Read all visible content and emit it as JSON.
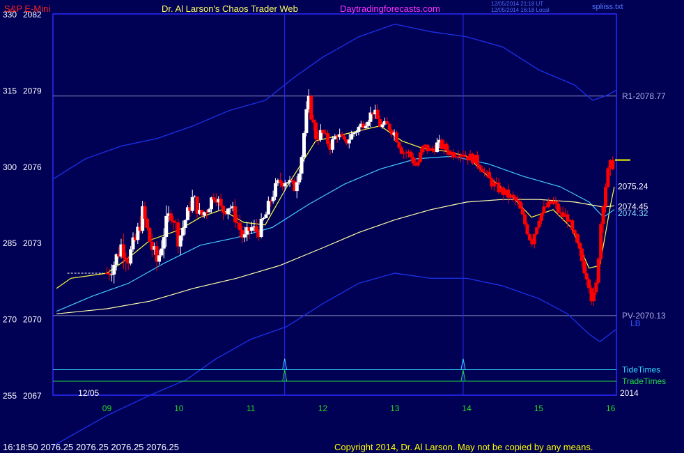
{
  "header": {
    "symbol": "S&P E-Mini",
    "title": "Dr. Al Larson's Chaos Trader Web",
    "site": "Daytradingforecasts.com",
    "utc_time": "12/05/2014 21:18 UT",
    "local_time": "12/05/2014 16:18 Local",
    "file": "spliiss.txt"
  },
  "footer": {
    "quote": "16:18:50  2076.25 2076.25 2076.25 2076.25",
    "copyright": "Copyright 2014, Dr. Al Larson. May not be copied by any means."
  },
  "colors": {
    "background": "#000055",
    "frame": "#2a2aff",
    "up_bar": "#ffffff",
    "down_bar": "#ff0000",
    "ema_fast": "#ffff44",
    "ema_mid": "#44ccff",
    "ema_slow": "#ffffaa",
    "band": "#1a2fe0",
    "tide": "#33ddff",
    "trade": "#22dd44",
    "time_label": "#22dd22",
    "price_label": "#ffff00"
  },
  "chart_data": {
    "type": "candlestick",
    "title": "S&P E-Mini",
    "y_axis": {
      "ylim": [
        2067,
        2082
      ],
      "ticks": [
        {
          "value": 2067,
          "label": "2067",
          "alt": "255"
        },
        {
          "value": 2070,
          "label": "2070",
          "alt": "270"
        },
        {
          "value": 2073,
          "label": "2073",
          "alt": "285"
        },
        {
          "value": 2076,
          "label": "2076",
          "alt": "300"
        },
        {
          "value": 2079,
          "label": "2079",
          "alt": "315"
        },
        {
          "value": 2082,
          "label": "2082",
          "alt": "330"
        }
      ]
    },
    "x_axis": {
      "xlim": [
        8.25,
        16.08
      ],
      "ticks": [
        "09",
        "10",
        "11",
        "12",
        "13",
        "14",
        "15",
        "16"
      ],
      "date_label": "12/05",
      "year_label": "2014"
    },
    "levels": [
      {
        "name": "R1",
        "label": "R1-2078.77",
        "value": 2078.77
      },
      {
        "name": "PV",
        "label": "PV-2070.13",
        "value": 2070.13
      }
    ],
    "band_label": "LB",
    "prev_close": {
      "from": 8.45,
      "to": 8.95,
      "value": 2071.8
    },
    "vertical_times": [
      11.47,
      13.95
    ],
    "timing_lines": [
      {
        "name": "TideTimes",
        "value": 2068.0,
        "spikes": [
          11.47,
          13.95
        ]
      },
      {
        "name": "TradeTimes",
        "value": 2067.55,
        "spikes": [
          11.47,
          13.95
        ]
      }
    ],
    "price_tags": [
      "2075.24",
      "2074.45",
      "2074.32"
    ],
    "last_price_marker": 2076.25,
    "path": [
      [
        9.0,
        2071.8
      ],
      [
        9.1,
        2072.2
      ],
      [
        9.2,
        2072.9
      ],
      [
        9.3,
        2072.4
      ],
      [
        9.4,
        2073.1
      ],
      [
        9.5,
        2074.2
      ],
      [
        9.6,
        2073.0
      ],
      [
        9.7,
        2072.2
      ],
      [
        9.8,
        2073.5
      ],
      [
        9.9,
        2074.3
      ],
      [
        10.0,
        2073.1
      ],
      [
        10.1,
        2074.0
      ],
      [
        10.2,
        2074.8
      ],
      [
        10.3,
        2074.0
      ],
      [
        10.4,
        2074.4
      ],
      [
        10.5,
        2075.0
      ],
      [
        10.6,
        2074.2
      ],
      [
        10.7,
        2074.5
      ],
      [
        10.8,
        2073.9
      ],
      [
        10.9,
        2073.1
      ],
      [
        11.0,
        2073.6
      ],
      [
        11.1,
        2073.4
      ],
      [
        11.2,
        2074.0
      ],
      [
        11.3,
        2074.9
      ],
      [
        11.4,
        2075.4
      ],
      [
        11.5,
        2075.5
      ],
      [
        11.6,
        2075.1
      ],
      [
        11.7,
        2076.3
      ],
      [
        11.75,
        2077.6
      ],
      [
        11.8,
        2078.6
      ],
      [
        11.9,
        2077.2
      ],
      [
        12.0,
        2077.3
      ],
      [
        12.1,
        2076.8
      ],
      [
        12.2,
        2077.3
      ],
      [
        12.3,
        2076.9
      ],
      [
        12.45,
        2077.4
      ],
      [
        12.6,
        2077.8
      ],
      [
        12.7,
        2078.2
      ],
      [
        12.8,
        2077.6
      ],
      [
        12.9,
        2077.6
      ],
      [
        13.0,
        2077.3
      ],
      [
        13.1,
        2076.6
      ],
      [
        13.2,
        2076.5
      ],
      [
        13.3,
        2076.0
      ],
      [
        13.4,
        2076.8
      ],
      [
        13.5,
        2076.6
      ],
      [
        13.6,
        2076.9
      ],
      [
        13.7,
        2076.7
      ],
      [
        13.8,
        2076.5
      ],
      [
        13.9,
        2076.6
      ],
      [
        14.0,
        2076.4
      ],
      [
        14.1,
        2076.3
      ],
      [
        14.2,
        2076.0
      ],
      [
        14.3,
        2075.5
      ],
      [
        14.4,
        2075.2
      ],
      [
        14.5,
        2075.0
      ],
      [
        14.6,
        2074.8
      ],
      [
        14.7,
        2074.6
      ],
      [
        14.8,
        2073.8
      ],
      [
        14.9,
        2073.0
      ],
      [
        15.0,
        2074.0
      ],
      [
        15.1,
        2074.4
      ],
      [
        15.2,
        2074.6
      ],
      [
        15.3,
        2074.1
      ],
      [
        15.4,
        2074.0
      ],
      [
        15.5,
        2073.1
      ],
      [
        15.6,
        2072.3
      ],
      [
        15.7,
        2071.5
      ],
      [
        15.75,
        2070.6
      ],
      [
        15.8,
        2071.3
      ],
      [
        15.85,
        2073.4
      ],
      [
        15.9,
        2074.8
      ],
      [
        15.95,
        2075.6
      ],
      [
        16.0,
        2076.0
      ],
      [
        16.05,
        2076.25
      ]
    ],
    "series": [
      {
        "name": "ema_fast",
        "points": [
          [
            8.3,
            2071.2
          ],
          [
            8.5,
            2071.6
          ],
          [
            9.0,
            2071.8
          ],
          [
            9.3,
            2072.4
          ],
          [
            9.6,
            2073.1
          ],
          [
            10.0,
            2073.5
          ],
          [
            10.3,
            2074.0
          ],
          [
            10.6,
            2074.3
          ],
          [
            10.9,
            2073.8
          ],
          [
            11.2,
            2073.7
          ],
          [
            11.5,
            2075.2
          ],
          [
            11.7,
            2076.1
          ],
          [
            11.9,
            2077.0
          ],
          [
            12.2,
            2077.2
          ],
          [
            12.5,
            2077.4
          ],
          [
            12.8,
            2077.6
          ],
          [
            13.1,
            2077.0
          ],
          [
            13.4,
            2076.7
          ],
          [
            13.7,
            2076.6
          ],
          [
            14.0,
            2076.4
          ],
          [
            14.3,
            2075.6
          ],
          [
            14.6,
            2074.9
          ],
          [
            14.9,
            2074.0
          ],
          [
            15.2,
            2074.3
          ],
          [
            15.45,
            2073.6
          ],
          [
            15.7,
            2072.0
          ],
          [
            15.85,
            2072.1
          ],
          [
            16.0,
            2074.5
          ],
          [
            16.05,
            2075.2
          ]
        ]
      },
      {
        "name": "ema_mid",
        "points": [
          [
            8.3,
            2070.3
          ],
          [
            8.8,
            2070.9
          ],
          [
            9.3,
            2071.4
          ],
          [
            9.8,
            2072.2
          ],
          [
            10.3,
            2072.9
          ],
          [
            10.8,
            2073.2
          ],
          [
            11.3,
            2073.6
          ],
          [
            11.8,
            2074.5
          ],
          [
            12.3,
            2075.3
          ],
          [
            12.8,
            2075.9
          ],
          [
            13.3,
            2076.3
          ],
          [
            13.8,
            2076.4
          ],
          [
            14.3,
            2076.1
          ],
          [
            14.8,
            2075.6
          ],
          [
            15.3,
            2075.2
          ],
          [
            15.7,
            2074.6
          ],
          [
            15.9,
            2074.0
          ],
          [
            16.05,
            2074.3
          ]
        ]
      },
      {
        "name": "ema_slow",
        "points": [
          [
            8.3,
            2070.2
          ],
          [
            9.0,
            2070.4
          ],
          [
            9.6,
            2070.7
          ],
          [
            10.2,
            2071.2
          ],
          [
            10.8,
            2071.6
          ],
          [
            11.4,
            2072.1
          ],
          [
            12.0,
            2072.8
          ],
          [
            12.5,
            2073.4
          ],
          [
            13.0,
            2073.9
          ],
          [
            13.5,
            2074.3
          ],
          [
            14.0,
            2074.6
          ],
          [
            14.5,
            2074.7
          ],
          [
            15.0,
            2074.7
          ],
          [
            15.5,
            2074.6
          ],
          [
            15.9,
            2074.4
          ],
          [
            16.05,
            2074.45
          ]
        ]
      },
      {
        "name": "upper_band",
        "points": [
          [
            8.25,
            2075.5
          ],
          [
            8.7,
            2076.3
          ],
          [
            9.2,
            2076.8
          ],
          [
            9.7,
            2077.1
          ],
          [
            10.2,
            2077.6
          ],
          [
            10.7,
            2078.2
          ],
          [
            11.2,
            2078.6
          ],
          [
            11.6,
            2079.5
          ],
          [
            12.0,
            2080.3
          ],
          [
            12.5,
            2081.1
          ],
          [
            13.0,
            2081.6
          ],
          [
            13.5,
            2081.3
          ],
          [
            14.0,
            2081.1
          ],
          [
            14.5,
            2080.7
          ],
          [
            15.0,
            2079.8
          ],
          [
            15.5,
            2079.2
          ],
          [
            15.75,
            2078.6
          ],
          [
            15.95,
            2078.8
          ],
          [
            16.08,
            2079.0
          ]
        ]
      },
      {
        "name": "lower_band",
        "points": [
          [
            8.25,
            2065.0
          ],
          [
            9.0,
            2066.2
          ],
          [
            9.6,
            2067.0
          ],
          [
            10.1,
            2067.6
          ],
          [
            10.5,
            2068.4
          ],
          [
            11.0,
            2069.2
          ],
          [
            11.5,
            2069.7
          ],
          [
            12.0,
            2070.6
          ],
          [
            12.5,
            2071.4
          ],
          [
            13.0,
            2071.8
          ],
          [
            13.5,
            2071.6
          ],
          [
            14.0,
            2071.6
          ],
          [
            14.5,
            2071.3
          ],
          [
            15.0,
            2070.8
          ],
          [
            15.4,
            2070.2
          ],
          [
            15.7,
            2069.4
          ],
          [
            15.85,
            2069.1
          ],
          [
            16.08,
            2069.6
          ]
        ]
      }
    ]
  }
}
